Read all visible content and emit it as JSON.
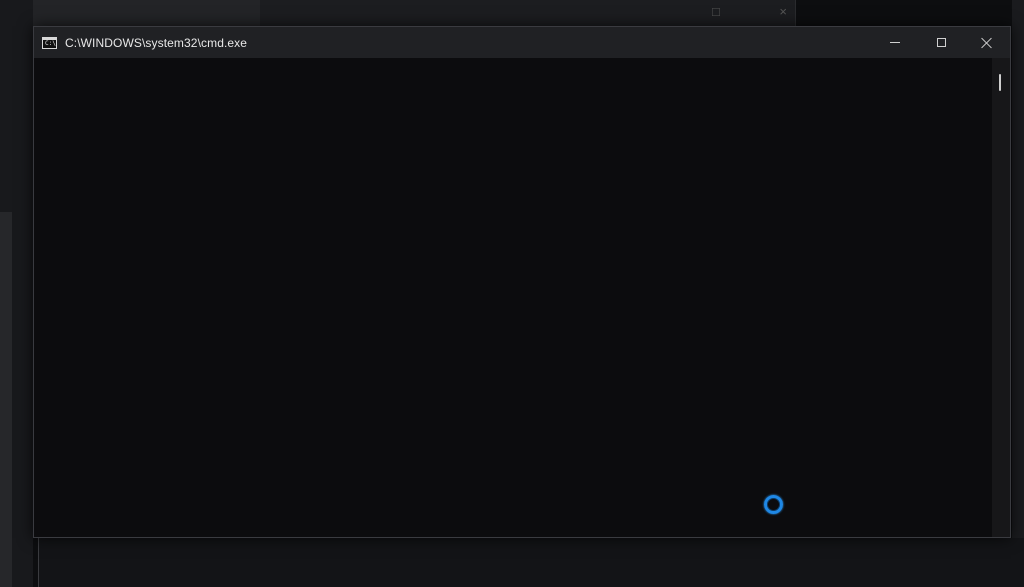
{
  "window": {
    "title": "C:\\WINDOWS\\system32\\cmd.exe",
    "icon": "command-prompt-icon"
  },
  "controls": {
    "minimize": "minimize-icon",
    "maximize": "maximize-icon",
    "close": "close-icon"
  },
  "background_window": {
    "minimize": "minimize-icon",
    "close": "close-icon"
  },
  "console": {
    "text": ""
  },
  "cursor": {
    "state": "busy",
    "icon": "loading-spinner-icon"
  },
  "colors": {
    "title_bar": "#202124",
    "console_background": "#0c0c0e",
    "busy_cursor": "#1f88e5"
  }
}
